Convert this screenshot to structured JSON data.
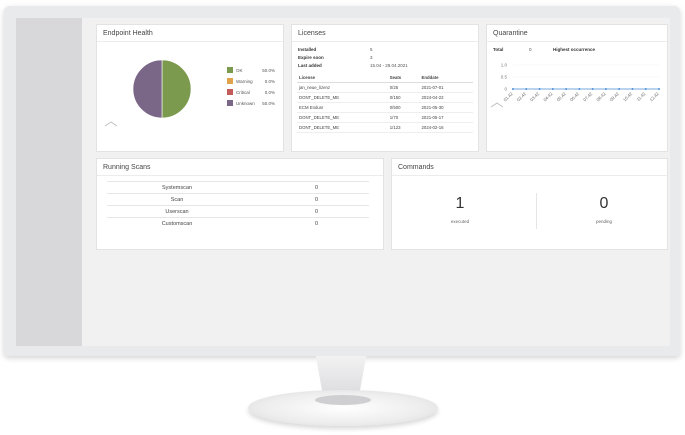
{
  "endpoint_health": {
    "title": "Endpoint Health",
    "legend": [
      {
        "label": "OK",
        "value": "50.0%",
        "color": "#7b9a4e"
      },
      {
        "label": "Warning",
        "value": "0.0%",
        "color": "#e0a24a"
      },
      {
        "label": "Critical",
        "value": "0.0%",
        "color": "#c45a5a"
      },
      {
        "label": "Unknown",
        "value": "50.0%",
        "color": "#7a6686"
      }
    ]
  },
  "licenses": {
    "title": "Licenses",
    "installed_label": "Installed",
    "installed_value": "5",
    "expire_label": "Expire soon",
    "expire_value": "3",
    "last_label": "Last added",
    "last_value": "15.04 - 29.04.2021",
    "columns": [
      "License",
      "Seats",
      "Enddate"
    ],
    "rows": [
      [
        "jan_neue_lizenz",
        "0/25",
        "2021-07-01"
      ],
      [
        "DONT_DELETE_ME",
        "0/150",
        "2024-04-22"
      ],
      [
        "ECM Endusr",
        "0/500",
        "2021-05-30"
      ],
      [
        "DONT_DELETE_ME",
        "1/70",
        "2021-05-17"
      ],
      [
        "DONT_DELETE_ME",
        "1/123",
        "2024-02-16"
      ]
    ]
  },
  "quarantine": {
    "title": "Quarantine",
    "total_label": "Total",
    "total_value": "0",
    "highest_label": "Highest occurrence",
    "chart_data": {
      "type": "line",
      "x": [
        "01.42",
        "02.42",
        "03.42",
        "04.42",
        "05.42",
        "06.42",
        "07.42",
        "08.42",
        "09.42",
        "10.42",
        "11.42",
        "12.42"
      ],
      "series": [
        {
          "values": [
            0,
            0,
            0,
            0,
            0,
            0,
            0,
            0,
            0,
            0,
            0,
            0
          ],
          "color": "#4a90d9"
        }
      ],
      "y_ticks": [
        "1.0",
        "0.5",
        "0"
      ],
      "ylim": [
        0,
        1
      ]
    }
  },
  "running_scans": {
    "title": "Running Scans",
    "rows": [
      {
        "name": "Systemscan",
        "value": "0"
      },
      {
        "name": "Scan",
        "value": "0"
      },
      {
        "name": "Userscan",
        "value": "0"
      },
      {
        "name": "Customscan",
        "value": "0"
      }
    ]
  },
  "commands": {
    "title": "Commands",
    "executed_value": "1",
    "executed_label": "executed",
    "pending_value": "0",
    "pending_label": "pending"
  }
}
